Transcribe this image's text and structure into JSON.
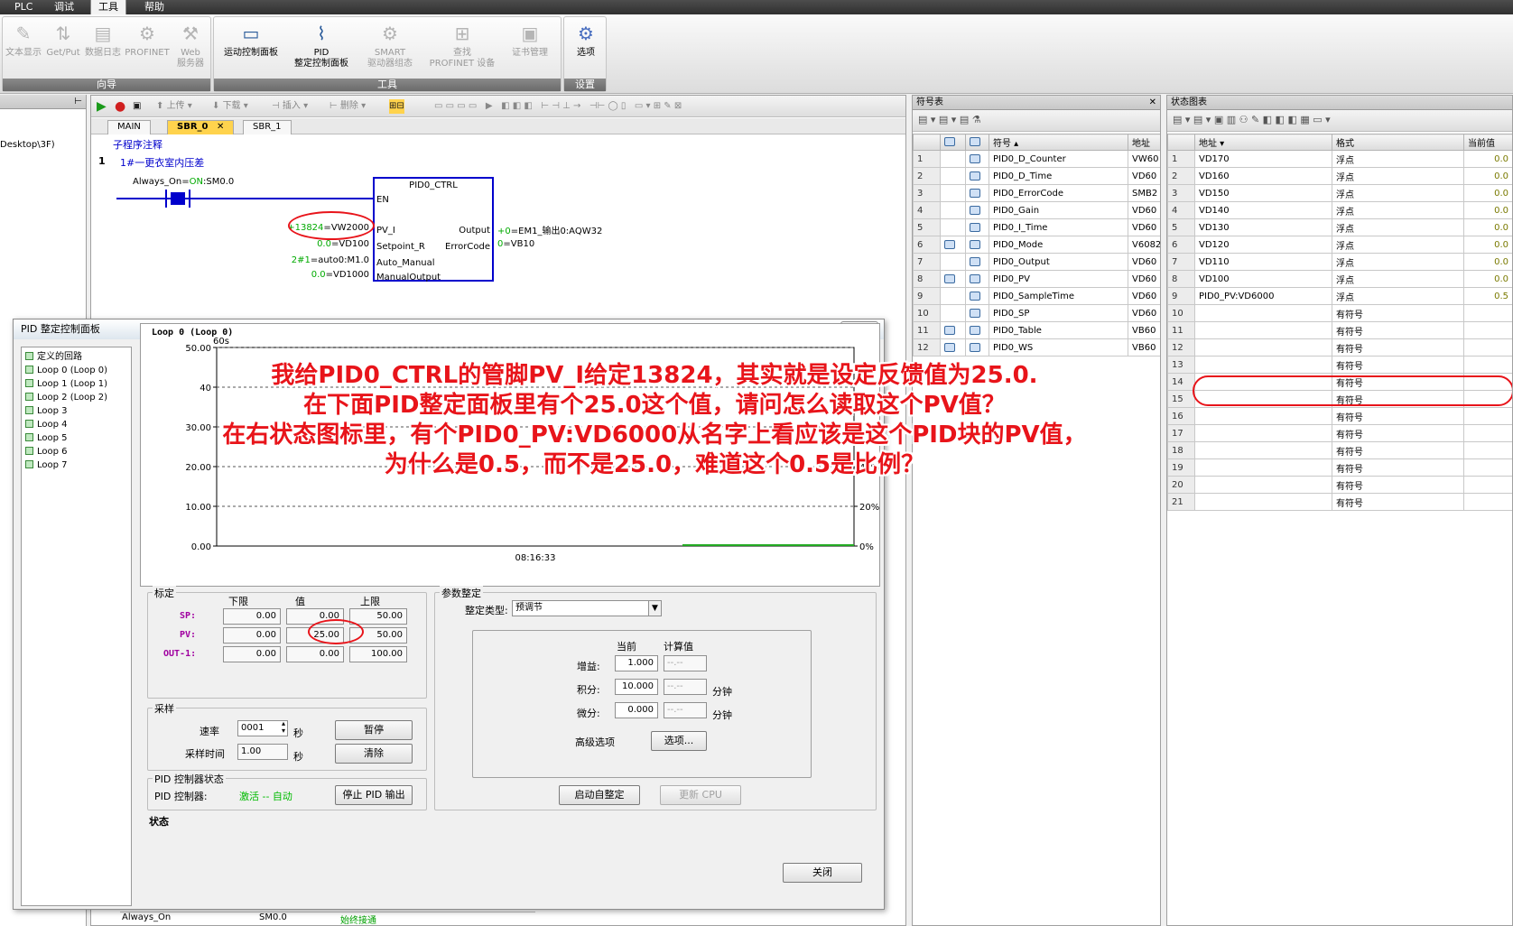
{
  "menu": [
    "PLC",
    "调试",
    "工具",
    "帮助"
  ],
  "menu_active": "工具",
  "ribbon": {
    "groups": [
      {
        "label": "向导",
        "buttons": [
          "文本显示",
          "Get/Put",
          "数据日志",
          "PROFINET",
          "Web\n服务器"
        ]
      },
      {
        "label": "工具",
        "buttons": [
          "运动控制面板",
          "PID\n整定控制面板",
          "SMART\n驱动器组态",
          "查找\nPROFINET 设备",
          "证书管理"
        ]
      },
      {
        "label": "设置",
        "buttons": [
          "选项"
        ]
      }
    ]
  },
  "left_panel": {
    "path_fragment": "Desktop\\3F)"
  },
  "editor": {
    "toolbar": [
      "上传",
      "下载",
      "插入",
      "删除"
    ],
    "tabs": [
      "MAIN",
      "SBR_0",
      "SBR_1"
    ],
    "active_tab": "SBR_0",
    "subroutine_comment": "子程序注释",
    "network_number": "1",
    "network_comment": "1#一更衣室内压差",
    "contact": {
      "symbol": "Always_On",
      "state": "ON",
      "addr": "SM0.0"
    },
    "block": {
      "name": "PID0_CTRL",
      "en": "EN"
    },
    "inputs": [
      {
        "value": "+13824",
        "addr": "VW2000",
        "pin": "PV_I"
      },
      {
        "value": "0.0",
        "addr": "VD100",
        "pin": "Setpoint_R"
      },
      {
        "value": "2#1",
        "addr": "auto0:M1.0",
        "pin": "Auto_Manual"
      },
      {
        "value": "0.0",
        "addr": "VD1000",
        "pin": "ManualOutput"
      }
    ],
    "outputs": [
      {
        "pin": "Output",
        "value": "+0",
        "addr": "EM1_输出0:AQW32"
      },
      {
        "pin": "ErrorCode",
        "value": "0",
        "addr": "VB10"
      }
    ],
    "bottom_row": {
      "symbol": "Always_On",
      "addr": "SM0.0",
      "comment": "始终接通"
    }
  },
  "symbol_table": {
    "title": "符号表",
    "headers": [
      "符号",
      "地址"
    ],
    "rows": [
      {
        "n": "1",
        "sym": "PID0_D_Counter",
        "addr": "VW60"
      },
      {
        "n": "2",
        "sym": "PID0_D_Time",
        "addr": "VD60"
      },
      {
        "n": "3",
        "sym": "PID0_ErrorCode",
        "addr": "SMB2"
      },
      {
        "n": "4",
        "sym": "PID0_Gain",
        "addr": "VD60"
      },
      {
        "n": "5",
        "sym": "PID0_I_Time",
        "addr": "VD60"
      },
      {
        "n": "6",
        "sym": "PID0_Mode",
        "addr": "V6082"
      },
      {
        "n": "7",
        "sym": "PID0_Output",
        "addr": "VD60"
      },
      {
        "n": "8",
        "sym": "PID0_PV",
        "addr": "VD60"
      },
      {
        "n": "9",
        "sym": "PID0_SampleTime",
        "addr": "VD60"
      },
      {
        "n": "10",
        "sym": "PID0_SP",
        "addr": "VD60"
      },
      {
        "n": "11",
        "sym": "PID0_Table",
        "addr": "VB60"
      },
      {
        "n": "12",
        "sym": "PID0_WS",
        "addr": "VB60"
      }
    ]
  },
  "status_table": {
    "title": "状态图表",
    "headers": [
      "地址",
      "格式",
      "当前值"
    ],
    "rows": [
      {
        "n": "1",
        "addr": "VD170",
        "fmt": "浮点",
        "val": "0.0"
      },
      {
        "n": "2",
        "addr": "VD160",
        "fmt": "浮点",
        "val": "0.0"
      },
      {
        "n": "3",
        "addr": "VD150",
        "fmt": "浮点",
        "val": "0.0"
      },
      {
        "n": "4",
        "addr": "VD140",
        "fmt": "浮点",
        "val": "0.0"
      },
      {
        "n": "5",
        "addr": "VD130",
        "fmt": "浮点",
        "val": "0.0"
      },
      {
        "n": "6",
        "addr": "VD120",
        "fmt": "浮点",
        "val": "0.0"
      },
      {
        "n": "7",
        "addr": "VD110",
        "fmt": "浮点",
        "val": "0.0"
      },
      {
        "n": "8",
        "addr": "VD100",
        "fmt": "浮点",
        "val": "0.0"
      },
      {
        "n": "9",
        "addr": "PID0_PV:VD6000",
        "fmt": "浮点",
        "val": "0.5"
      },
      {
        "n": "10",
        "addr": "",
        "fmt": "有符号",
        "val": ""
      },
      {
        "n": "11",
        "addr": "",
        "fmt": "有符号",
        "val": ""
      },
      {
        "n": "12",
        "addr": "",
        "fmt": "有符号",
        "val": ""
      },
      {
        "n": "13",
        "addr": "",
        "fmt": "有符号",
        "val": ""
      },
      {
        "n": "14",
        "addr": "",
        "fmt": "有符号",
        "val": ""
      },
      {
        "n": "15",
        "addr": "",
        "fmt": "有符号",
        "val": ""
      },
      {
        "n": "16",
        "addr": "",
        "fmt": "有符号",
        "val": ""
      },
      {
        "n": "17",
        "addr": "",
        "fmt": "有符号",
        "val": ""
      },
      {
        "n": "18",
        "addr": "",
        "fmt": "有符号",
        "val": ""
      },
      {
        "n": "19",
        "addr": "",
        "fmt": "有符号",
        "val": ""
      },
      {
        "n": "20",
        "addr": "",
        "fmt": "有符号",
        "val": ""
      },
      {
        "n": "21",
        "addr": "",
        "fmt": "有符号",
        "val": ""
      }
    ]
  },
  "pid_dialog": {
    "title": "PID 整定控制面板",
    "close_x": "x",
    "loops": [
      "定义的回路",
      "Loop 0 (Loop 0)",
      "Loop 1 (Loop 1)",
      "Loop 2 (Loop 2)",
      "Loop 3",
      "Loop 4",
      "Loop 5",
      "Loop 6",
      "Loop 7"
    ],
    "chart_header": "Loop 0 (Loop 0)",
    "chart_time_label": "60s",
    "chart_time": "08:16:33",
    "calib": {
      "title": "标定",
      "headers": [
        "下限",
        "值",
        "上限"
      ],
      "rows": [
        {
          "label": "SP:",
          "low": "0.00",
          "val": "0.00",
          "high": "50.00"
        },
        {
          "label": "PV:",
          "low": "0.00",
          "val": "25.00",
          "high": "50.00"
        },
        {
          "label": "OUT-1:",
          "low": "0.00",
          "val": "0.00",
          "high": "100.00"
        }
      ]
    },
    "sampling": {
      "title": "采样",
      "rate_label": "速率",
      "rate": "0001",
      "rate_unit": "秒",
      "time_label": "采样时间",
      "time": "1.00",
      "time_unit": "秒",
      "pause": "暂停",
      "clear": "清除"
    },
    "controller": {
      "title": "PID 控制器状态",
      "label": "PID 控制器:",
      "state": "激活 -- 自动",
      "stop_button": "停止 PID 输出"
    },
    "status_label": "状态",
    "tuning": {
      "title": "参数整定",
      "type_label": "整定类型:",
      "type_value": "预调节",
      "col_current": "当前",
      "col_calc": "计算值",
      "gain_label": "增益:",
      "gain": "1.000",
      "gain_calc": "--.--",
      "int_label": "积分:",
      "int": "10.000",
      "int_calc": "--.--",
      "int_unit": "分钟",
      "der_label": "微分:",
      "der": "0.000",
      "der_calc": "--.--",
      "der_unit": "分钟",
      "adv_label": "高级选项",
      "adv_button": "选项...",
      "start_button": "启动自整定",
      "update_button": "更新 CPU"
    },
    "close_button": "关闭"
  },
  "chart_data": {
    "type": "line",
    "title": "",
    "y_left_ticks": [
      "0.00",
      "10.00",
      "20.00",
      "30.00",
      "40",
      "50.00"
    ],
    "y_right_ticks": [
      "0%",
      "20%",
      "40%"
    ],
    "ylim": [
      0,
      50
    ],
    "x_label": "08:16:33",
    "series": [
      {
        "values": [
          0,
          0,
          0,
          0
        ],
        "color": "#22aa22"
      }
    ],
    "grid": true
  },
  "annotation": [
    "我给PID0_CTRL的管脚PV_I给定13824，其实就是设定反馈值为25.0.",
    "在下面PID整定面板里有个25.0这个值，请问怎么读取这个PV值？",
    "在右状态图标里，有个PID0_PV:VD6000从名字上看应该是这个PID块的PV值，",
    "为什么是0.5，而不是25.0，难道这个0.5是比例？"
  ],
  "colors": {
    "annotation": "#e8141a",
    "active_tab": "#ffd34d",
    "status_ok": "#00bb00"
  }
}
